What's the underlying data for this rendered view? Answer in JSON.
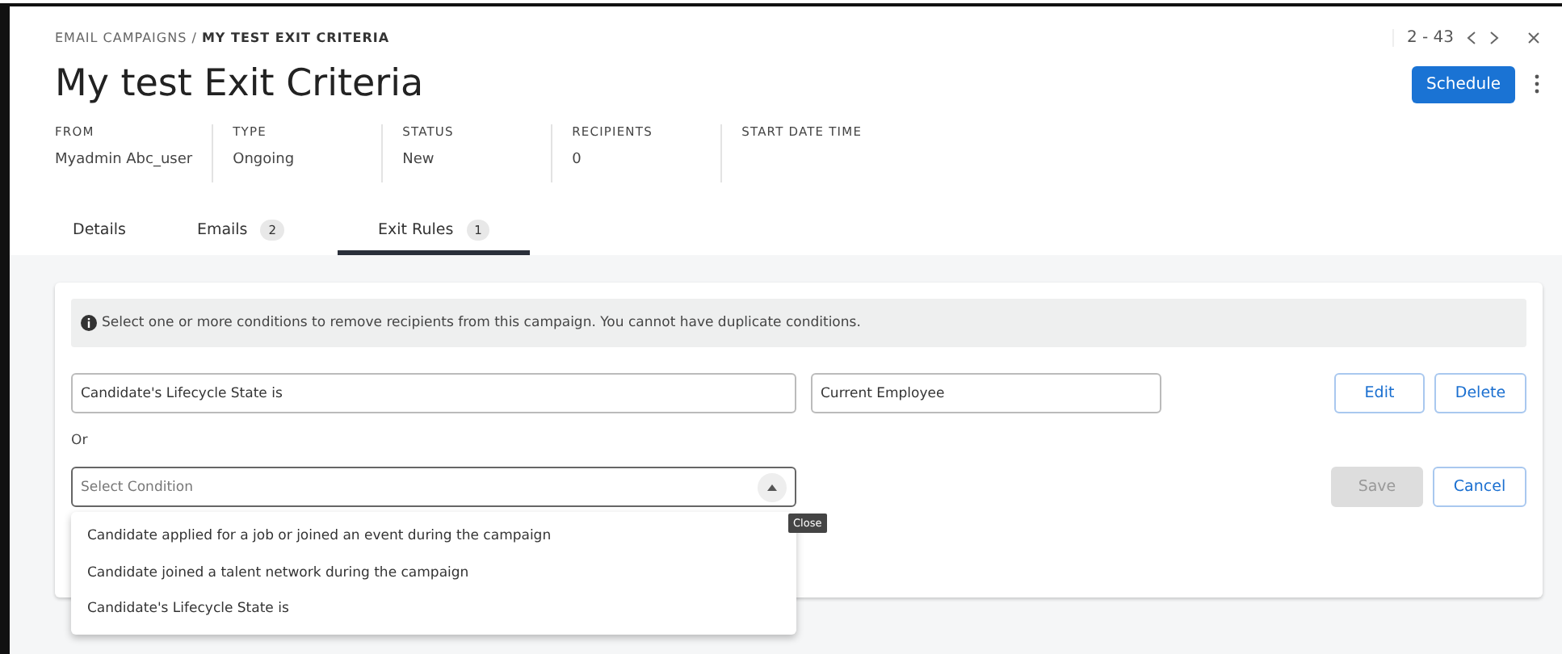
{
  "breadcrumb": {
    "parent": "EMAIL CAMPAIGNS",
    "separator": "/",
    "current": "MY TEST EXIT CRITERIA"
  },
  "pager": {
    "range": "2 - 43"
  },
  "title": "My test Exit Criteria",
  "primary_button": "Schedule",
  "meta": [
    {
      "label": "FROM",
      "value": "Myadmin Abc_user"
    },
    {
      "label": "TYPE",
      "value": "Ongoing"
    },
    {
      "label": "STATUS",
      "value": "New"
    },
    {
      "label": "RECIPIENTS",
      "value": "0"
    },
    {
      "label": "START DATE TIME"
    }
  ],
  "tabs": [
    {
      "label": "Details",
      "selected": false
    },
    {
      "label": "Emails",
      "count": "2",
      "selected": false
    },
    {
      "label": "Exit Rules",
      "count": "1",
      "selected": true
    }
  ],
  "info": "Select one or more conditions to remove recipients from this campaign. You cannot have duplicate conditions.",
  "rule": {
    "condition": "Candidate's Lifecycle State is",
    "value": "Current Employee",
    "buttons": [
      "Edit",
      "Delete"
    ]
  },
  "connector": "Or",
  "new_rule": {
    "placeholder": "Select Condition",
    "expanded": true,
    "tooltip": "Close",
    "save": {
      "label": "Save",
      "disabled": true
    },
    "cancel": "Cancel",
    "options": [
      "Candidate applied for a job or joined an event during the campaign",
      "Candidate joined a talent network during the campaign",
      "Candidate's Lifecycle State is"
    ]
  }
}
